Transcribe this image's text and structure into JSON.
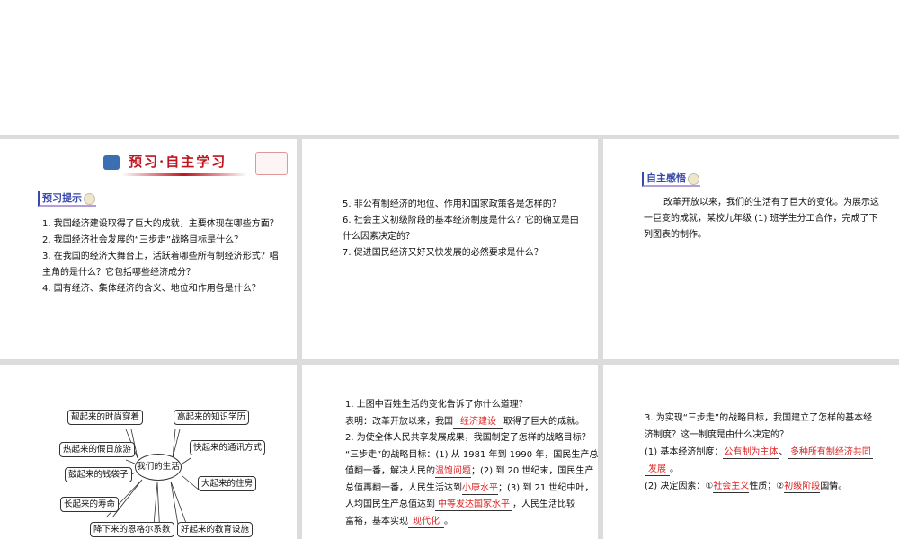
{
  "slide1": {
    "banner": "预习·自主学习",
    "tag": "预习提示",
    "items": [
      "1. 我国经济建设取得了巨大的成就，主要体现在哪些方面？",
      "2. 我国经济社会发展的“三步走”战略目标是什么？",
      "3. 在我国的经济大舞台上，活跃着哪些所有制经济形式？唱",
      "主角的是什么？它包括哪些经济成分？",
      "4. 国有经济、集体经济的含义、地位和作用各是什么？"
    ]
  },
  "slide2": {
    "items": [
      "5. 非公有制经济的地位、作用和国家政策各是怎样的？",
      "6. 社会主义初级阶段的基本经济制度是什么？它的确立是由",
      "什么因素决定的？",
      "7. 促进国民经济又好又快发展的必然要求是什么？"
    ]
  },
  "slide3": {
    "tag": "自主感悟",
    "para": "改革开放以来，我们的生活有了巨大的变化。为展示这一巨变的成就，某校九年级 (1) 班学生分工合作，完成了下列图表的制作。"
  },
  "slide4": {
    "center": "我们的生活",
    "boxes": [
      "靓起来的时尚穿着",
      "高起来的知识学历",
      "热起来的假日旅游",
      "快起来的通讯方式",
      "鼓起来的钱袋子",
      "大起来的住房",
      "长起来的寿命",
      "降下来的恩格尔系数",
      "好起来的教育设施"
    ]
  },
  "slide5": {
    "q1": "1. 上图中百姓生活的变化告诉了你什么道理？",
    "a1_pre": "表明：改革开放以来，我国",
    "a1_ans": "经济建设",
    "a1_post": "取得了巨大的成就。",
    "q2": "2. 为使全体人民共享发展成果，我国制定了怎样的战略目标？",
    "l1": "“三步走”的战略目标：(1) 从 1981 年到 1990 年，国民生产总",
    "l2_pre": "值翻一番，解决人民的",
    "l2_ans": "温饱问题",
    "l2_post": "；(2) 到 20 世纪末，国民生产",
    "l3_pre": "总值再翻一番，人民生活达到",
    "l3_ans": "小康水平",
    "l3_post": "；(3) 到 21 世纪中叶，",
    "l4_pre": "人均国民生产总值达到",
    "l4_ans": "中等发达国家水平",
    "l4_post": "，人民生活比较",
    "l5_pre": "富裕，基本实现",
    "l5_ans": "现代化",
    "l5_post": "。"
  },
  "slide6": {
    "q3a": "3. 为实现“三步走”的战略目标，我国建立了怎样的基本经",
    "q3b": "济制度？这一制度是由什么决定的？",
    "b1_pre": "(1) 基本经济制度：",
    "b1_ans1": "公有制为主体",
    "b1_sep": "、",
    "b1_ans2": "多种所有制经济共同",
    "b1_ans3": "发展",
    "b1_end": "。",
    "b2_pre": "(2) 决定因素：①",
    "b2_ans1": "社会主义",
    "b2_mid": "性质；②",
    "b2_ans2": "初级阶段",
    "b2_end": "国情。"
  }
}
